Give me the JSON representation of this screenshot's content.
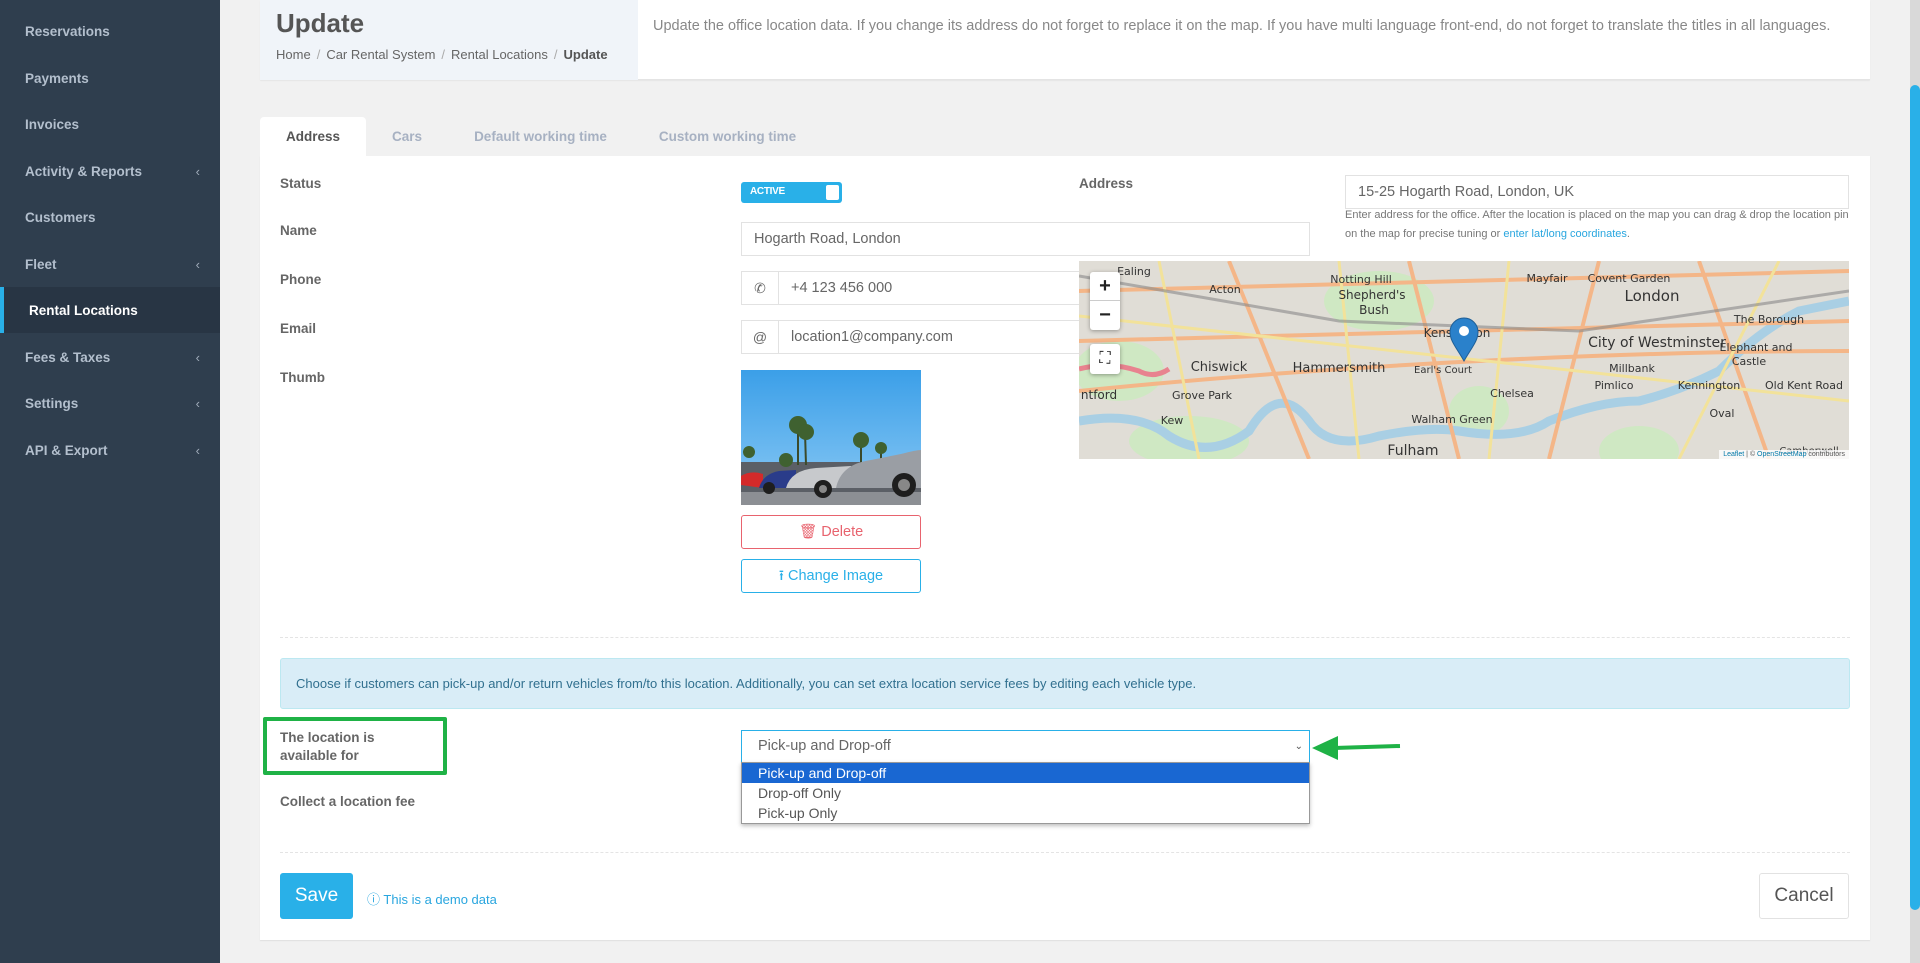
{
  "sidebar": {
    "items": [
      {
        "label": "Reservations",
        "has_children": false,
        "active": false
      },
      {
        "label": "Payments",
        "has_children": false,
        "active": false
      },
      {
        "label": "Invoices",
        "has_children": false,
        "active": false
      },
      {
        "label": "Activity & Reports",
        "has_children": true,
        "active": false
      },
      {
        "label": "Customers",
        "has_children": false,
        "active": false
      },
      {
        "label": "Fleet",
        "has_children": true,
        "active": false
      },
      {
        "label": "Rental Locations",
        "has_children": false,
        "active": true
      },
      {
        "label": "Fees & Taxes",
        "has_children": true,
        "active": false
      },
      {
        "label": "Settings",
        "has_children": true,
        "active": false
      },
      {
        "label": "API & Export",
        "has_children": true,
        "active": false
      }
    ],
    "chevron_glyph": "‹"
  },
  "header": {
    "title": "Update",
    "breadcrumb": [
      "Home",
      "Car Rental System",
      "Rental Locations",
      "Update"
    ],
    "breadcrumb_sep": "/",
    "description": "Update the office location data. If you change its address do not forget to replace it on the map. If you have multi language front-end, do not forget to translate the titles in all languages."
  },
  "tabs": [
    {
      "label": "Address",
      "active": true
    },
    {
      "label": "Cars",
      "active": false
    },
    {
      "label": "Default working time",
      "active": false
    },
    {
      "label": "Custom working time",
      "active": false
    }
  ],
  "form": {
    "status": {
      "label": "Status",
      "value": "ACTIVE",
      "on": true
    },
    "name": {
      "label": "Name",
      "value": "Hogarth Road, London"
    },
    "phone": {
      "label": "Phone",
      "value": "+4 123 456 000",
      "icon": "phone-icon",
      "glyph": "✆"
    },
    "email": {
      "label": "Email",
      "value": "location1@company.com",
      "icon": "at-icon",
      "glyph": "@"
    },
    "thumb": {
      "label": "Thumb",
      "delete_label": "Delete",
      "change_label": "Change Image",
      "delete_icon": "trash-icon",
      "change_icon": "upload-icon"
    },
    "address": {
      "label": "Address",
      "value": "15-25 Hogarth Road, London, UK",
      "help_text": "Enter address for the office. After the location is placed on the map you can drag & drop the location pin on the map for precise tuning or",
      "help_link": "enter lat/long coordinates",
      "help_end": "."
    },
    "map": {
      "zoom_in": "+",
      "zoom_out": "−",
      "fullscreen_icon": "fullscreen-icon",
      "attribution_leaflet": "Leaflet",
      "attribution_sep": " | © ",
      "attribution_osm": "OpenStreetMap",
      "attribution_end": " contributors",
      "place_labels": [
        {
          "name": "Ealing"
        },
        {
          "name": "Acton"
        },
        {
          "name": "Notting Hill"
        },
        {
          "name": "Shepherd's"
        },
        {
          "name": "Bush"
        },
        {
          "name": "Mayfair"
        },
        {
          "name": "Covent Garden"
        },
        {
          "name": "London"
        },
        {
          "name": "The Borough"
        },
        {
          "name": "Kensington"
        },
        {
          "name": "City of Westminster"
        },
        {
          "name": "Elephant and"
        },
        {
          "name": "Castle"
        },
        {
          "name": "Chiswick"
        },
        {
          "name": "Hammersmith"
        },
        {
          "name": "Earl's Court"
        },
        {
          "name": "Millbank"
        },
        {
          "name": "Pimlico"
        },
        {
          "name": "Kennington"
        },
        {
          "name": "Old Kent Road"
        },
        {
          "name": "ntford"
        },
        {
          "name": "Grove Park"
        },
        {
          "name": "Chelsea"
        },
        {
          "name": "Kew"
        },
        {
          "name": "Walham Green"
        },
        {
          "name": "Oval"
        },
        {
          "name": "Fulham"
        },
        {
          "name": "Camberwell"
        }
      ]
    },
    "availability": {
      "info": "Choose if customers can pick-up and/or return vehicles from/to this location. Additionally, you can set extra location service fees by editing each vehicle type.",
      "label": "The location is available for",
      "selected": "Pick-up and Drop-off",
      "options": [
        "Pick-up and Drop-off",
        "Drop-off Only",
        "Pick-up Only"
      ],
      "dropdown_open": true,
      "caret": "⌄"
    },
    "location_fee": {
      "label": "Collect a location fee"
    },
    "save_label": "Save",
    "cancel_label": "Cancel",
    "demo_note": "This is a demo data",
    "demo_icon": "info-icon"
  },
  "annotation": {
    "highlight_color": "#1fb246"
  },
  "colors": {
    "accent": "#29b0e8",
    "danger": "#e8636e",
    "sidebar_bg": "#2f3e4e",
    "option_selected": "#1967d2"
  }
}
